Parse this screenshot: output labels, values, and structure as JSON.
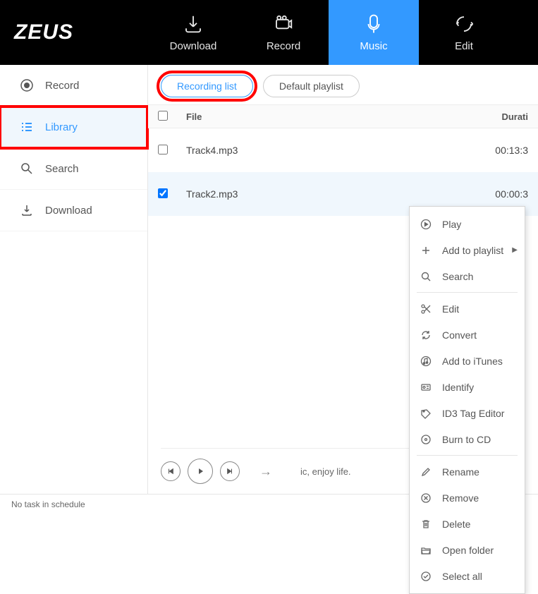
{
  "app": {
    "logo": "ZEUS"
  },
  "nav": {
    "items": [
      {
        "id": "download",
        "label": "Download"
      },
      {
        "id": "record",
        "label": "Record"
      },
      {
        "id": "music",
        "label": "Music"
      },
      {
        "id": "edit",
        "label": "Edit"
      }
    ],
    "active": "music"
  },
  "sidebar": {
    "items": [
      {
        "id": "record",
        "label": "Record"
      },
      {
        "id": "library",
        "label": "Library"
      },
      {
        "id": "search",
        "label": "Search"
      },
      {
        "id": "download",
        "label": "Download"
      }
    ],
    "active": "library",
    "highlighted": "library"
  },
  "pills": {
    "items": [
      {
        "id": "recording",
        "label": "Recording list"
      },
      {
        "id": "default",
        "label": "Default playlist"
      }
    ],
    "active": "recording",
    "highlighted": "recording"
  },
  "table": {
    "columns": {
      "file": "File",
      "duration": "Durati"
    },
    "rows": [
      {
        "file": "Track4.mp3",
        "duration": "00:13:3",
        "checked": false,
        "selected": false
      },
      {
        "file": "Track2.mp3",
        "duration": "00:00:3",
        "checked": true,
        "selected": true
      }
    ]
  },
  "context_menu": {
    "groups": [
      [
        {
          "id": "play",
          "label": "Play"
        },
        {
          "id": "add-playlist",
          "label": "Add to playlist",
          "submenu": true
        },
        {
          "id": "search",
          "label": "Search"
        }
      ],
      [
        {
          "id": "edit",
          "label": "Edit"
        },
        {
          "id": "convert",
          "label": "Convert"
        },
        {
          "id": "add-itunes",
          "label": "Add to iTunes"
        },
        {
          "id": "identify",
          "label": "Identify"
        },
        {
          "id": "id3",
          "label": "ID3 Tag Editor"
        },
        {
          "id": "burn",
          "label": "Burn to CD"
        }
      ],
      [
        {
          "id": "rename",
          "label": "Rename"
        },
        {
          "id": "remove",
          "label": "Remove"
        },
        {
          "id": "delete",
          "label": "Delete"
        },
        {
          "id": "open-folder",
          "label": "Open folder"
        },
        {
          "id": "select-all",
          "label": "Select all"
        }
      ]
    ]
  },
  "playbar": {
    "tagline": "ic, enjoy life."
  },
  "footer": {
    "status": "No task in schedule"
  },
  "icons": {
    "download": "download",
    "record": "record",
    "music": "music",
    "edit": "edit",
    "record-dot": "record-dot",
    "library": "list",
    "search": "search",
    "download-sm": "download-sm"
  }
}
